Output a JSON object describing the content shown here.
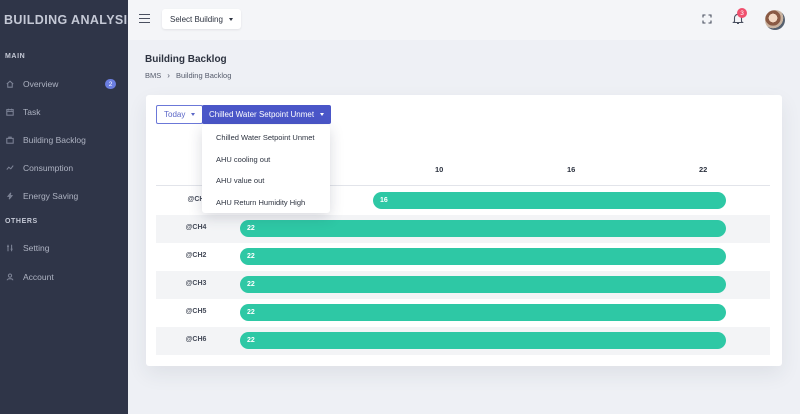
{
  "sidebar": {
    "brand": "BUILDING ANALYSIS",
    "sections": {
      "main": "MAIN",
      "others": "OTHERS"
    },
    "items": [
      {
        "label": "Overview",
        "icon": "home-icon",
        "badge": "2"
      },
      {
        "label": "Task",
        "icon": "calendar-icon"
      },
      {
        "label": "Building Backlog",
        "icon": "briefcase-icon"
      },
      {
        "label": "Consumption",
        "icon": "chart-line-icon"
      },
      {
        "label": "Energy Saving",
        "icon": "bolt-icon"
      },
      {
        "label": "Setting",
        "icon": "sliders-icon"
      },
      {
        "label": "Account",
        "icon": "user-icon"
      }
    ]
  },
  "topbar": {
    "select_building": "Select Building",
    "notifications_count": "3"
  },
  "page": {
    "title": "Building Backlog",
    "breadcrumb": [
      "BMS",
      "Building Backlog"
    ]
  },
  "filters": {
    "period": "Today",
    "metric": "Chilled Water Setpoint Unmet",
    "metric_options": [
      "Chilled Water Setpoint Unmet",
      "AHU cooling out",
      "AHU value out",
      "AHU Return Humidity High"
    ]
  },
  "chart_data": {
    "type": "bar",
    "orientation": "horizontal-gantt",
    "x_ticks": [
      "10",
      "16",
      "22"
    ],
    "rows": [
      {
        "label": "@CH",
        "value": "16"
      },
      {
        "label": "@CH4",
        "value": "22"
      },
      {
        "label": "@CH2",
        "value": "22"
      },
      {
        "label": "@CH3",
        "value": "22"
      },
      {
        "label": "@CH5",
        "value": "22"
      },
      {
        "label": "@CH6",
        "value": "22"
      }
    ],
    "bar_color": "#2ec8a5"
  },
  "colors": {
    "accent": "#4a56c8",
    "sidebar": "#2f3548",
    "bar": "#2ec8a5",
    "alert": "#f0506e"
  }
}
